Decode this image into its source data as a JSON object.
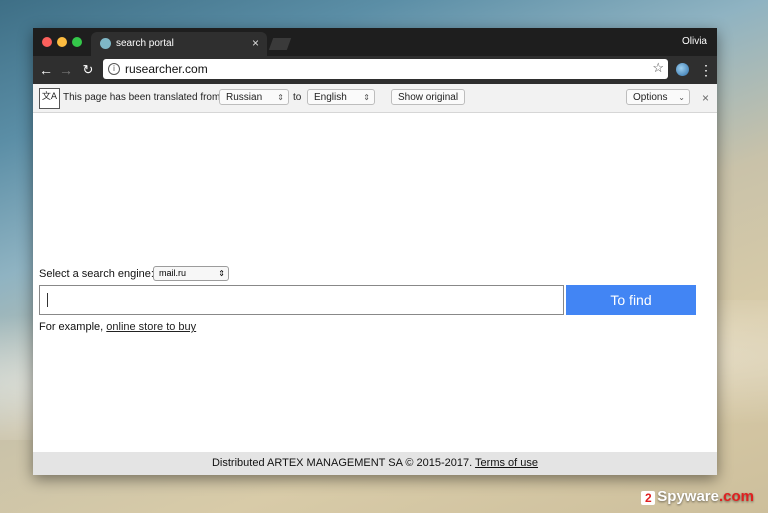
{
  "tab": {
    "title": "search portal"
  },
  "profile": {
    "name": "Olivia"
  },
  "omnibox": {
    "url": "rusearcher.com"
  },
  "translate_bar": {
    "prefix": "This page has been translated from",
    "from_language": "Russian",
    "to_word": "to",
    "to_language": "English",
    "show_original": "Show original",
    "options": "Options"
  },
  "search": {
    "engine_label": "Select a search engine:",
    "engine_value": "mail.ru",
    "input_value": "",
    "find_button": "To find",
    "example_prefix": "For example,",
    "example_link": "online store to buy"
  },
  "footer": {
    "text": "Distributed ARTEX MANAGEMENT SA © 2015-2017.",
    "terms_link": "Terms of use"
  },
  "watermark": {
    "logo": "2",
    "text": "Spyware",
    "suffix": ".com"
  },
  "colors": {
    "find_button": "#4285f4",
    "titlebar": "#1e1e1e"
  }
}
